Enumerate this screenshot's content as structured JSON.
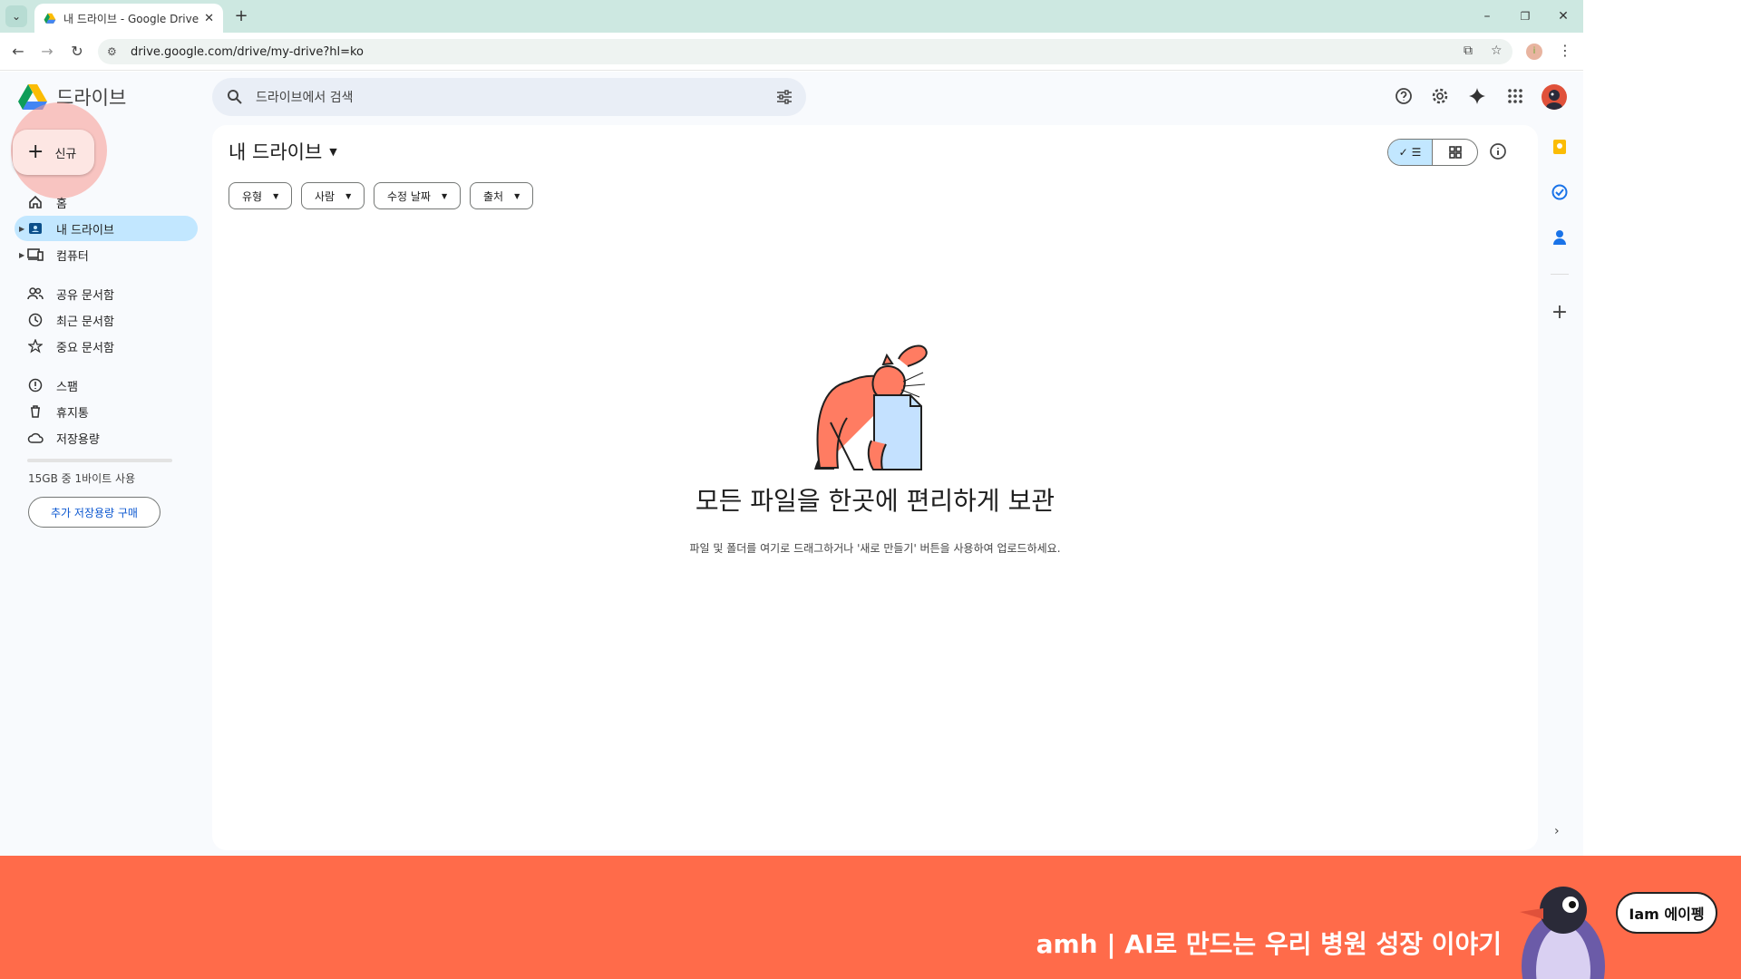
{
  "browser": {
    "tab_title": "내 드라이브 - Google Drive",
    "url": "drive.google.com/drive/my-drive?hl=ko"
  },
  "drive": {
    "logo_text": "드라이브",
    "new_label": "신규",
    "search_placeholder": "드라이브에서 검색",
    "nav": [
      {
        "label": "홈",
        "icon": "home-icon"
      },
      {
        "label": "내 드라이브",
        "icon": "my-drive-icon"
      },
      {
        "label": "컴퓨터",
        "icon": "computer-icon"
      },
      {
        "label": "공유 문서함",
        "icon": "shared-icon"
      },
      {
        "label": "최근 문서함",
        "icon": "clock-icon"
      },
      {
        "label": "중요 문서함",
        "icon": "star-icon"
      },
      {
        "label": "스팸",
        "icon": "spam-icon"
      },
      {
        "label": "휴지통",
        "icon": "trash-icon"
      },
      {
        "label": "저장용량",
        "icon": "cloud-icon"
      }
    ],
    "storage_text": "15GB 중 1바이트 사용",
    "storage_used_fraction": 0.0,
    "buy_storage": "추가 저장용량 구매",
    "page_title": "내 드라이브",
    "filters": [
      "유형",
      "사람",
      "수정 날짜",
      "출처"
    ],
    "empty_title": "모든 파일을 한곳에 편리하게 보관",
    "empty_subtitle": "파일 및 폴더를 여기로 드래그하거나 '새로 만들기' 버튼을 사용하여 업로드하세요."
  },
  "banner": {
    "text": "amh | AI로 만드는 우리 병원 성장 이야기",
    "bubble": "Iam 에이펭"
  },
  "colors": {
    "banner": "#ff6b4a",
    "active_nav": "#c2e7ff",
    "link": "#0b57d0"
  }
}
